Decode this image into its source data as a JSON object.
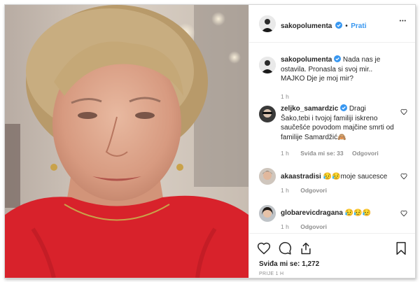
{
  "header": {
    "username": "sakopolumenta",
    "follow_separator": "•",
    "follow_label": "Prati",
    "more_label": "•••"
  },
  "caption": {
    "username": "sakopolumenta",
    "text": "Nada nas je ostavila. Pronasla si svoj mir.. MAJKO Dje je moj mir?",
    "time": "1 h"
  },
  "comments": [
    {
      "username": "zeljko_samardzic",
      "text": "Dragi Šako,tebi i tvojoj familiji iskreno saučešće povodom majčine smrti od familije Samardžić🙈",
      "time": "1 h",
      "likes": "Sviđa mi se: 33",
      "reply": "Odgovori"
    },
    {
      "username": "akaastradisi",
      "text": "😥😥moje saucesce",
      "time": "1 h",
      "reply": "Odgovori"
    },
    {
      "username": "globarevicdragana",
      "text": "😥😥😥",
      "time": "1 h",
      "reply": "Odgovori"
    }
  ],
  "footer": {
    "likes": "Sviđa mi se: 1,272",
    "timestamp": "PRIJE 1 H"
  },
  "colors": {
    "accent_blue": "#3897f0",
    "text": "#262626",
    "muted": "#8e8e8e",
    "photo_red": "#d8222b"
  },
  "icons": [
    "verified-icon",
    "more-icon",
    "heart-icon",
    "comment-icon",
    "share-icon",
    "bookmark-icon"
  ]
}
